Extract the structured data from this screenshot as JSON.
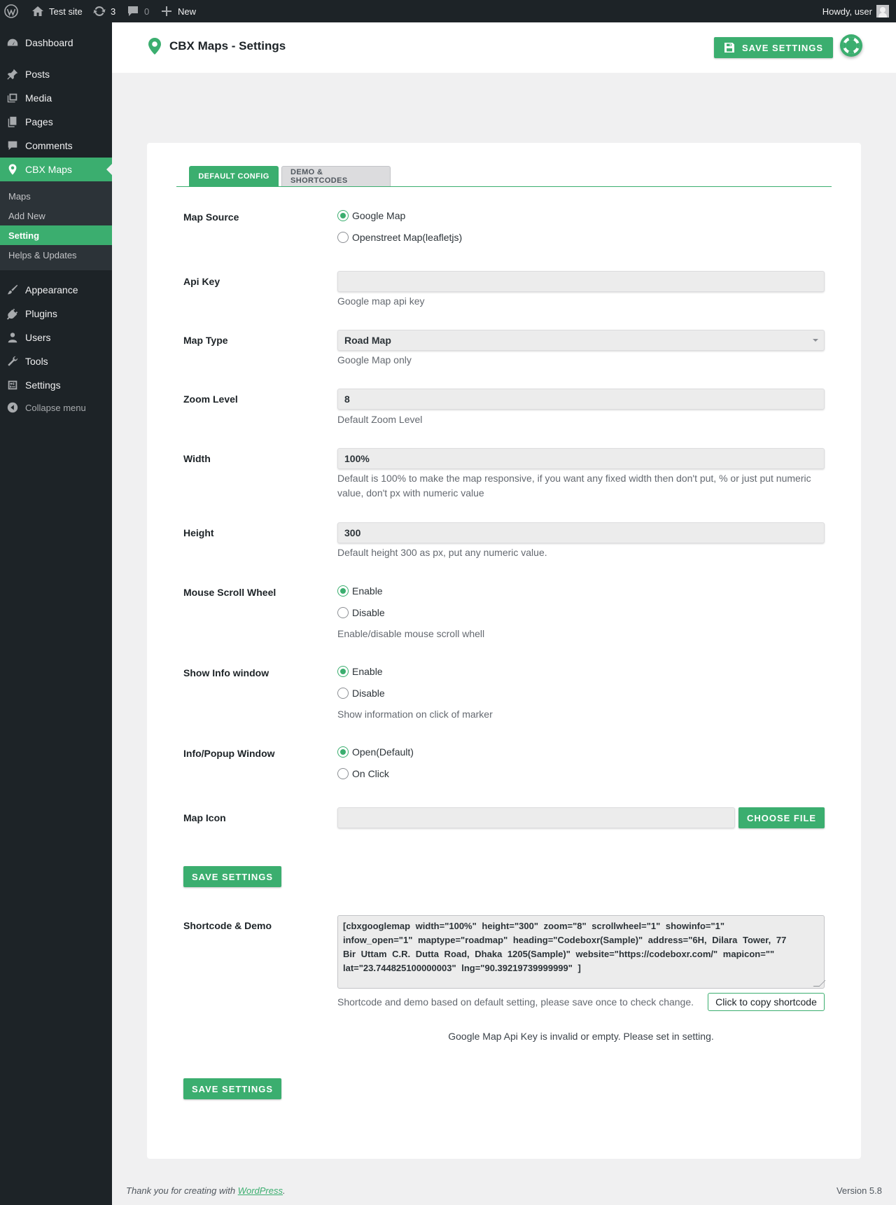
{
  "adminbar": {
    "site_name": "Test site",
    "updates_count": "3",
    "comments_count": "0",
    "new_label": "New",
    "howdy": "Howdy, user"
  },
  "sidebar": {
    "items": [
      {
        "label": "Dashboard",
        "icon": "dashboard-icon"
      },
      {
        "label": "Posts",
        "icon": "pin-icon"
      },
      {
        "label": "Media",
        "icon": "media-icon"
      },
      {
        "label": "Pages",
        "icon": "pages-icon"
      },
      {
        "label": "Comments",
        "icon": "comment-icon"
      },
      {
        "label": "CBX Maps",
        "icon": "map-pin-icon"
      },
      {
        "label": "Appearance",
        "icon": "brush-icon"
      },
      {
        "label": "Plugins",
        "icon": "plugin-icon"
      },
      {
        "label": "Users",
        "icon": "user-icon"
      },
      {
        "label": "Tools",
        "icon": "wrench-icon"
      },
      {
        "label": "Settings",
        "icon": "settings-icon"
      }
    ],
    "submenu": [
      "Maps",
      "Add New",
      "Setting",
      "Helps & Updates"
    ],
    "collapse_label": "Collapse menu"
  },
  "header": {
    "title": "CBX Maps - Settings",
    "save_label": "Save Settings"
  },
  "tabs": [
    "Default Config",
    "Demo & Shortcodes"
  ],
  "form": {
    "map_source": {
      "label": "Map Source",
      "options": [
        "Google Map",
        "Openstreet Map(leafletjs)"
      ],
      "selected": 0
    },
    "api_key": {
      "label": "Api Key",
      "value": "",
      "desc": "Google map api key"
    },
    "map_type": {
      "label": "Map Type",
      "value": "Road Map",
      "desc": "Google Map only"
    },
    "zoom_level": {
      "label": "Zoom Level",
      "value": "8",
      "desc": "Default Zoom Level"
    },
    "width": {
      "label": "Width",
      "value": "100%",
      "desc_line1": "Default is 100% to make the map responsive, if you want any fixed width then don't put, % or just put numeric",
      "desc_line2": "value, don't px with numeric value"
    },
    "height": {
      "label": "Height",
      "value": "300",
      "desc": "Default height 300 as px, put any numeric value."
    },
    "scroll_wheel": {
      "label": "Mouse Scroll Wheel",
      "options": [
        "Enable",
        "Disable"
      ],
      "selected": 0,
      "desc": "Enable/disable mouse scroll whell"
    },
    "info_window": {
      "label": "Show Info window",
      "options": [
        "Enable",
        "Disable"
      ],
      "selected": 0,
      "desc": "Show information on click of marker"
    },
    "popup_window": {
      "label": "Info/Popup Window",
      "options": [
        "Open(Default)",
        "On Click"
      ],
      "selected": 0
    },
    "map_icon": {
      "label": "Map Icon",
      "value": "",
      "button": "Choose File"
    },
    "save_label": "Save Settings"
  },
  "shortcode": {
    "label": "Shortcode & Demo",
    "line1": "[cbxgooglemap  width=\"100%\"  height=\"300\"  zoom=\"8\"  scrollwheel=\"1\"  showinfo=\"1\"",
    "line2": "infow_open=\"1\"  maptype=\"roadmap\"  heading=\"Codeboxr(Sample)\"  address=\"6H, Dilara Tower, 77",
    "line3": "Bir Uttam C.R. Dutta Road, Dhaka 1205(Sample)\"  website=\"https://codeboxr.com/\"  mapicon=\"\"",
    "line4": "lat=\"23.744825100000003\"  lng=\"90.39219739999999\" ]",
    "desc": "Shortcode and demo based on default setting, please save once to check change.",
    "copy_label": "Click to copy shortcode",
    "api_message": "Google Map Api Key is invalid or empty. Please set in setting."
  },
  "footer": {
    "thanks_prefix": "Thank you for creating with ",
    "thanks_link": "WordPress",
    "thanks_suffix": ".",
    "version": "Version 5.8"
  },
  "colors": {
    "accent": "#3bae6f",
    "adminbar_bg": "#1d2327",
    "submenu_bg": "#2c3338"
  }
}
